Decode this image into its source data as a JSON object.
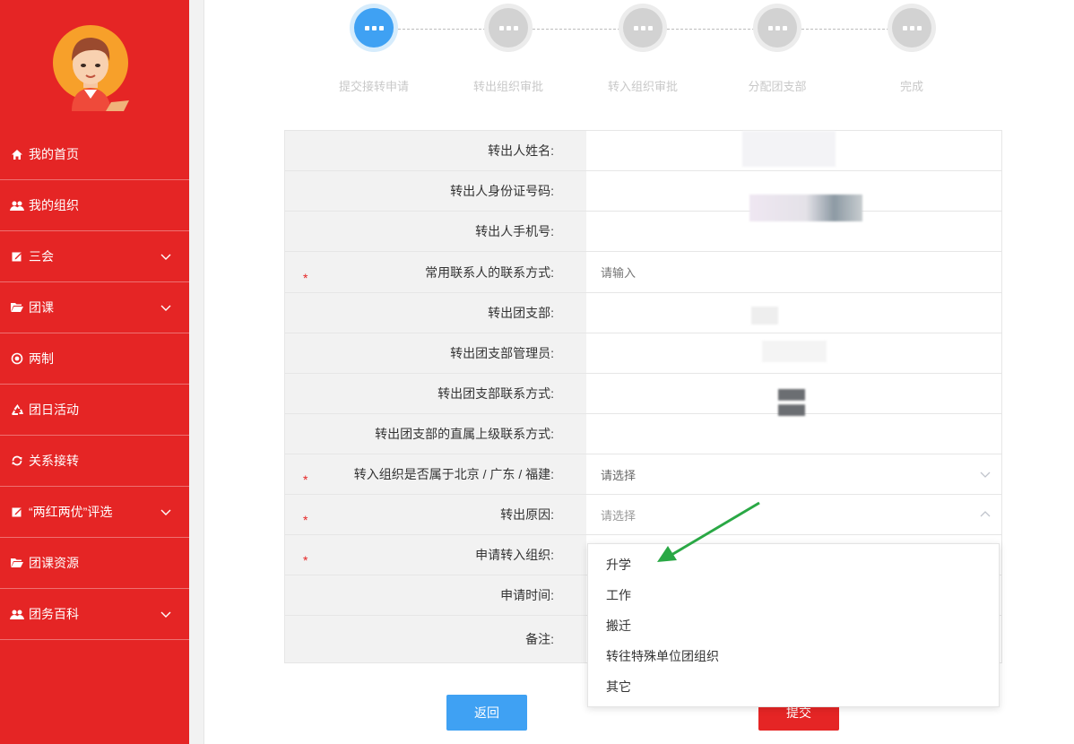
{
  "sidebar": {
    "items": [
      {
        "label": "我的首页",
        "icon": "home-icon",
        "has_submenu": false
      },
      {
        "label": "我的组织",
        "icon": "users-icon",
        "has_submenu": false
      },
      {
        "label": "三会",
        "icon": "edit-icon",
        "has_submenu": true
      },
      {
        "label": "团课",
        "icon": "folder-open-icon",
        "has_submenu": true
      },
      {
        "label": "两制",
        "icon": "target-icon",
        "has_submenu": false
      },
      {
        "label": "团日活动",
        "icon": "recycle-icon",
        "has_submenu": false
      },
      {
        "label": "关系接转",
        "icon": "refresh-icon",
        "has_submenu": false
      },
      {
        "label": "“两红两优”评选",
        "icon": "edit-icon",
        "has_submenu": true
      },
      {
        "label": "团课资源",
        "icon": "folder-open-icon",
        "has_submenu": false
      },
      {
        "label": "团务百科",
        "icon": "users-icon",
        "has_submenu": true
      }
    ]
  },
  "steps": [
    {
      "label": "提交接转申请",
      "active": true
    },
    {
      "label": "转出组织审批",
      "active": false
    },
    {
      "label": "转入组织审批",
      "active": false
    },
    {
      "label": "分配团支部",
      "active": false
    },
    {
      "label": "完成",
      "active": false
    }
  ],
  "form": {
    "rows": [
      {
        "label": "转出人姓名:",
        "value": "",
        "required": false
      },
      {
        "label": "转出人身份证号码:",
        "value": "",
        "required": false
      },
      {
        "label": "转出人手机号:",
        "value": "",
        "required": false
      },
      {
        "label": "常用联系人的联系方式:",
        "value": "请输入",
        "required": true
      },
      {
        "label": "转出团支部:",
        "value": "",
        "required": false
      },
      {
        "label": "转出团支部管理员:",
        "value": "",
        "required": false
      },
      {
        "label": "转出团支部联系方式:",
        "value": "",
        "required": false
      },
      {
        "label": "转出团支部的直属上级联系方式:",
        "value": "",
        "required": false
      },
      {
        "label": "转入组织是否属于北京 / 广东 / 福建:",
        "value": "请选择",
        "required": true
      },
      {
        "label": "转出原因:",
        "value": "请选择",
        "required": true
      },
      {
        "label": "申请转入组织:",
        "value": "",
        "required": true
      },
      {
        "label": "申请时间:",
        "value": "",
        "required": false
      },
      {
        "label": "备注:",
        "value": "",
        "required": false
      }
    ],
    "required_mark": "*"
  },
  "dropdown": {
    "options": [
      "升学",
      "工作",
      "搬迁",
      "转往特殊单位团组织",
      "其它"
    ]
  },
  "buttons": {
    "back_label": "返回",
    "submit_label": "提交"
  },
  "colors": {
    "sidebar_red": "#e52525",
    "step_active": "#3fa1f3",
    "step_inactive": "#d2d2d2",
    "arrow_green": "#2aa845"
  }
}
